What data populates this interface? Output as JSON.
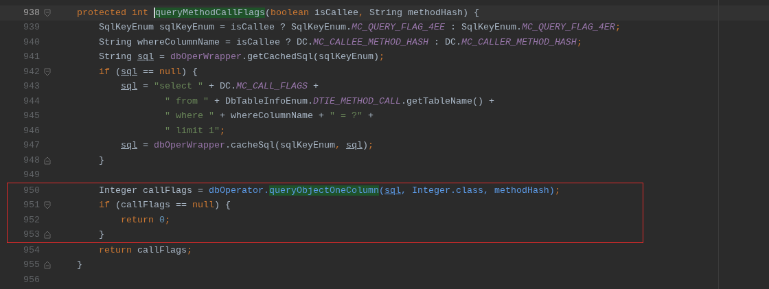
{
  "editor": {
    "blocks": [
      {
        "boxed": false,
        "lines": [
          {
            "number": "938",
            "current": true,
            "kind": "depth1",
            "fold_start": true,
            "fold_end": false,
            "tokens": [
              {
                "text": "protected int ",
                "kind": "keyword"
              },
              {
                "text": "queryMethodCallFlags",
                "kind": "match",
                "caret": true
              },
              {
                "text": "(",
                "kind": "plain"
              },
              {
                "text": "boolean ",
                "kind": "keyword"
              },
              {
                "text": "isCallee",
                "kind": "plain"
              },
              {
                "text": ", ",
                "kind": "keyword"
              },
              {
                "text": "String methodHash) {",
                "kind": "plain"
              }
            ]
          },
          {
            "number": "939",
            "current": false,
            "kind": "depth2",
            "fold_start": false,
            "fold_end": false,
            "tokens": [
              {
                "text": "SqlKeyEnum sqlKeyEnum = isCallee ? SqlKeyEnum.",
                "kind": "plain"
              },
              {
                "text": "MC_QUERY_FLAG_4EE",
                "kind": "static"
              },
              {
                "text": " : SqlKeyEnum.",
                "kind": "plain"
              },
              {
                "text": "MC_QUERY_FLAG_4ER",
                "kind": "static"
              },
              {
                "text": ";",
                "kind": "keyword"
              }
            ]
          },
          {
            "number": "940",
            "current": false,
            "kind": "depth2",
            "fold_start": false,
            "fold_end": false,
            "tokens": [
              {
                "text": "String whereColumnName = isCallee ? DC.",
                "kind": "plain"
              },
              {
                "text": "MC_CALLEE_METHOD_HASH",
                "kind": "static"
              },
              {
                "text": " : DC.",
                "kind": "plain"
              },
              {
                "text": "MC_CALLER_METHOD_HASH",
                "kind": "static"
              },
              {
                "text": ";",
                "kind": "keyword"
              }
            ]
          },
          {
            "number": "941",
            "current": false,
            "kind": "depth2",
            "fold_start": false,
            "fold_end": false,
            "tokens": [
              {
                "text": "String ",
                "kind": "plain"
              },
              {
                "text": "sql",
                "kind": "local"
              },
              {
                "text": " = ",
                "kind": "plain"
              },
              {
                "text": "dbOperWrapper",
                "kind": "field"
              },
              {
                "text": ".getCachedSql(sqlKeyEnum)",
                "kind": "plain"
              },
              {
                "text": ";",
                "kind": "keyword"
              }
            ]
          },
          {
            "number": "942",
            "current": false,
            "kind": "depth2",
            "fold_start": true,
            "fold_end": false,
            "tokens": [
              {
                "text": "if ",
                "kind": "keyword"
              },
              {
                "text": "(",
                "kind": "plain"
              },
              {
                "text": "sql",
                "kind": "local"
              },
              {
                "text": " == ",
                "kind": "plain"
              },
              {
                "text": "null",
                "kind": "keyword"
              },
              {
                "text": ") {",
                "kind": "plain"
              }
            ]
          },
          {
            "number": "943",
            "current": false,
            "kind": "depth3",
            "fold_start": false,
            "fold_end": false,
            "tokens": [
              {
                "text": "sql",
                "kind": "local"
              },
              {
                "text": " = ",
                "kind": "plain"
              },
              {
                "text": "\"select \"",
                "kind": "string"
              },
              {
                "text": " + DC.",
                "kind": "plain"
              },
              {
                "text": "MC_CALL_FLAGS",
                "kind": "static"
              },
              {
                "text": " +",
                "kind": "plain"
              }
            ]
          },
          {
            "number": "944",
            "current": false,
            "kind": "depth5",
            "fold_start": false,
            "fold_end": false,
            "tokens": [
              {
                "text": "\" from \"",
                "kind": "string"
              },
              {
                "text": " + DbTableInfoEnum.",
                "kind": "plain"
              },
              {
                "text": "DTIE_METHOD_CALL",
                "kind": "static"
              },
              {
                "text": ".getTableName() +",
                "kind": "plain"
              }
            ]
          },
          {
            "number": "945",
            "current": false,
            "kind": "depth5",
            "fold_start": false,
            "fold_end": false,
            "tokens": [
              {
                "text": "\" where \"",
                "kind": "string"
              },
              {
                "text": " + whereColumnName + ",
                "kind": "plain"
              },
              {
                "text": "\" = ?\"",
                "kind": "string"
              },
              {
                "text": " +",
                "kind": "plain"
              }
            ]
          },
          {
            "number": "946",
            "current": false,
            "kind": "depth5",
            "fold_start": false,
            "fold_end": false,
            "tokens": [
              {
                "text": "\" limit 1\"",
                "kind": "string"
              },
              {
                "text": ";",
                "kind": "keyword"
              }
            ]
          },
          {
            "number": "947",
            "current": false,
            "kind": "depth3",
            "fold_start": false,
            "fold_end": false,
            "tokens": [
              {
                "text": "sql",
                "kind": "local"
              },
              {
                "text": " = ",
                "kind": "plain"
              },
              {
                "text": "dbOperWrapper",
                "kind": "field"
              },
              {
                "text": ".cacheSql(sqlKeyEnum",
                "kind": "plain"
              },
              {
                "text": ", ",
                "kind": "keyword"
              },
              {
                "text": "sql",
                "kind": "local"
              },
              {
                "text": ")",
                "kind": "plain"
              },
              {
                "text": ";",
                "kind": "keyword"
              }
            ]
          },
          {
            "number": "948",
            "current": false,
            "kind": "depth2",
            "fold_start": false,
            "fold_end": true,
            "tokens": [
              {
                "text": "}",
                "kind": "plain"
              }
            ]
          },
          {
            "number": "949",
            "current": false,
            "fold_start": false,
            "fold_end": false
          }
        ]
      },
      {
        "boxed": true,
        "lines": [
          {
            "number": "950",
            "current": false,
            "kind": "depth2",
            "fold_start": false,
            "fold_end": false,
            "tokens": [
              {
                "text": "Integer callFlags = ",
                "kind": "plain"
              },
              {
                "text": "dbOperator.",
                "kind": "blue"
              },
              {
                "text": "queryObjectOneColumn",
                "kind": "match-blue"
              },
              {
                "text": "(",
                "kind": "blue"
              },
              {
                "text": "sql",
                "kind": "blue-local"
              },
              {
                "text": ", Integer.class, methodHash)",
                "kind": "blue"
              },
              {
                "text": ";",
                "kind": "keyword"
              }
            ]
          },
          {
            "number": "951",
            "current": false,
            "kind": "depth2",
            "fold_start": true,
            "fold_end": false,
            "tokens": [
              {
                "text": "if ",
                "kind": "keyword"
              },
              {
                "text": "(callFlags == ",
                "kind": "plain"
              },
              {
                "text": "null",
                "kind": "keyword"
              },
              {
                "text": ") {",
                "kind": "plain"
              }
            ]
          },
          {
            "number": "952",
            "current": false,
            "kind": "depth3",
            "fold_start": false,
            "fold_end": false,
            "tokens": [
              {
                "text": "return ",
                "kind": "keyword"
              },
              {
                "text": "0",
                "kind": "number"
              },
              {
                "text": ";",
                "kind": "keyword"
              }
            ]
          },
          {
            "number": "953",
            "current": false,
            "kind": "depth2",
            "fold_start": false,
            "fold_end": true,
            "tokens": [
              {
                "text": "}",
                "kind": "plain"
              }
            ]
          }
        ]
      },
      {
        "boxed": false,
        "lines": [
          {
            "number": "954",
            "current": false,
            "kind": "depth2",
            "fold_start": false,
            "fold_end": false,
            "tokens": [
              {
                "text": "return ",
                "kind": "keyword"
              },
              {
                "text": "callFlags",
                "kind": "plain"
              },
              {
                "text": ";",
                "kind": "keyword"
              }
            ]
          },
          {
            "number": "955",
            "current": false,
            "kind": "depth1",
            "fold_start": false,
            "fold_end": true,
            "tokens": [
              {
                "text": "}",
                "kind": "plain"
              }
            ]
          },
          {
            "number": "956",
            "current": false,
            "fold_start": false,
            "fold_end": false
          }
        ]
      }
    ]
  }
}
